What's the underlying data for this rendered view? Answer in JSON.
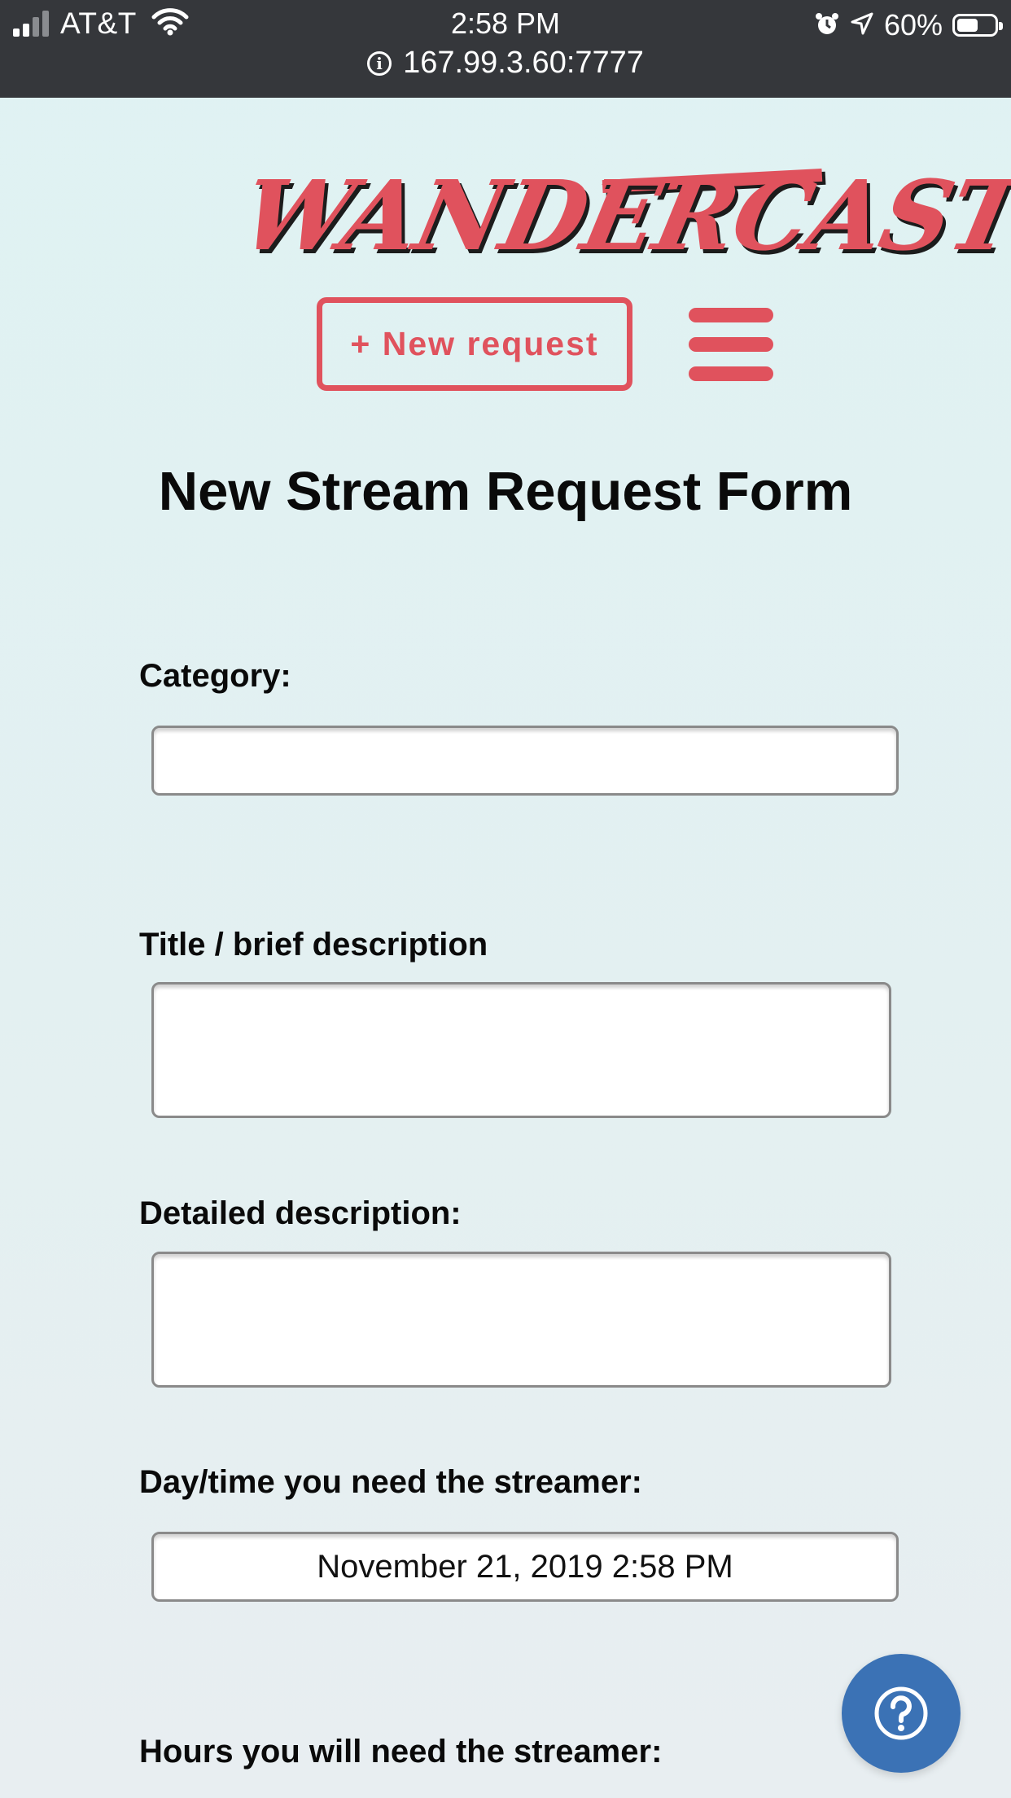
{
  "status_bar": {
    "carrier": "AT&T",
    "time": "2:58 PM",
    "battery_percent": "60%",
    "url": "167.99.3.60:7777",
    "icons": [
      "signal-icon",
      "wifi-icon",
      "alarm-icon",
      "location-arrow-icon",
      "battery-icon",
      "info-icon"
    ]
  },
  "header": {
    "logo_text": "WANDERCAST",
    "new_request_label": "+ New request",
    "menu_icon": "hamburger-menu-icon"
  },
  "form": {
    "title": "New Stream Request Form",
    "category": {
      "label": "Category:",
      "value": ""
    },
    "title_field": {
      "label": "Title / brief description",
      "value": ""
    },
    "detailed": {
      "label": "Detailed description:",
      "value": ""
    },
    "datetime": {
      "label": "Day/time you need the streamer:",
      "value": "November 21, 2019 2:58 PM"
    },
    "hours": {
      "label": "Hours you will need the streamer:"
    }
  },
  "help": {
    "icon": "question-circle-icon"
  },
  "colors": {
    "brand": "#e0525d",
    "help": "#3b72b5",
    "statusbar": "#35373b"
  }
}
